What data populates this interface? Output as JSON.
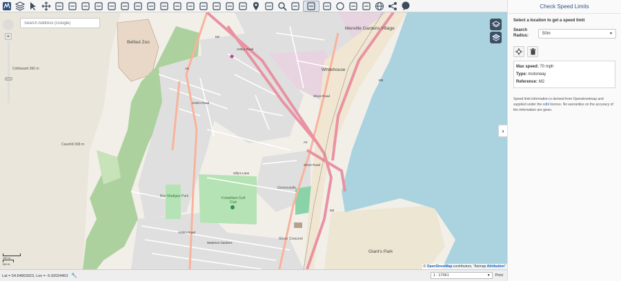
{
  "toolbar": {
    "tools": [
      "logo-icon",
      "layers-icon",
      "pointer-icon",
      "move-icon",
      "draw-icon",
      "vertex-icon",
      "route-icon",
      "speedometer-icon",
      "camera-icon",
      "document-icon",
      "delete-icon",
      "copy-icon",
      "tree-icon",
      "ruler-icon",
      "polygon-icon",
      "measure-icon",
      "zoom-in-icon",
      "compass-icon",
      "target-icon",
      "marker-icon",
      "wrench-icon",
      "search-icon",
      "anchor-icon",
      "lasso-icon",
      "photo-icon",
      "circle-icon",
      "list-icon",
      "table-icon",
      "globe-icon",
      "share-icon",
      "chat-icon"
    ]
  },
  "map": {
    "search_placeholder": "Search Address (Google)",
    "labels": {
      "belfast_zoo": "Belfast Zoo",
      "collinward": "Collinward 360 m",
      "cavehill": "Cavehill 368 m",
      "arthur_road": "Arthur Road",
      "mencille": "Menville Gardens Village",
      "whitehouse": "Whitehouse",
      "m2_a": "M2",
      "m2_b": "M2",
      "m2_c": "M2",
      "m5": "M5",
      "a6": "A6",
      "a2": "A2",
      "antrim_road": "Antrim Road",
      "antrim_road_2": "Antrim Road",
      "shore_road": "Shore Road",
      "shore_road_2": "Shore Road",
      "gillys_lane": "Gilly's Lane",
      "greencastle": "Greencastle",
      "fortwilliam": "Fortwilliam Golf Club",
      "ben_madigan": "Ben Madigan Park",
      "shore_crescent": "Shore Crescent",
      "giants_park": "Giant's Park",
      "waterton": "Waterton Gardens"
    },
    "scale_bar": [
      "100 m",
      "500 ft"
    ],
    "attribution": {
      "prefix": "©",
      "osm": "OpenStreetMap",
      "middle": "contributors, \"Azimap",
      "link": "Attribution",
      "suffix": "\""
    }
  },
  "statusbar": {
    "coords": "Lat = 54.64863923, Lon = -5.92024453",
    "scale_value": "1 : 17061",
    "print_label": "Print"
  },
  "panel": {
    "title": "Check Speed Limits",
    "subtitle": "Select a location to get a speed limit",
    "radius_label": "Search Radius:",
    "radius_value": "50m",
    "result": {
      "max_speed_label": "Max speed:",
      "max_speed_value": "70 mph",
      "type_label": "Type:",
      "type_value": "motorway",
      "reference_label": "Reference:",
      "reference_value": "M2"
    },
    "disclaimer_1": "Speed limit information is derived from Openstreetmap and supplied under the",
    "disclaimer_link": "odbl",
    "disclaimer_2": "licence. No warranties on the accuracy of the information are given."
  },
  "colors": {
    "motorway": "#e892a2",
    "trunk": "#f9b29c",
    "water": "#aad3df",
    "forest": "#add19e",
    "residential": "#e0dfdf",
    "panel_title": "#2d5686",
    "layer_btn": "#3d4f63"
  }
}
